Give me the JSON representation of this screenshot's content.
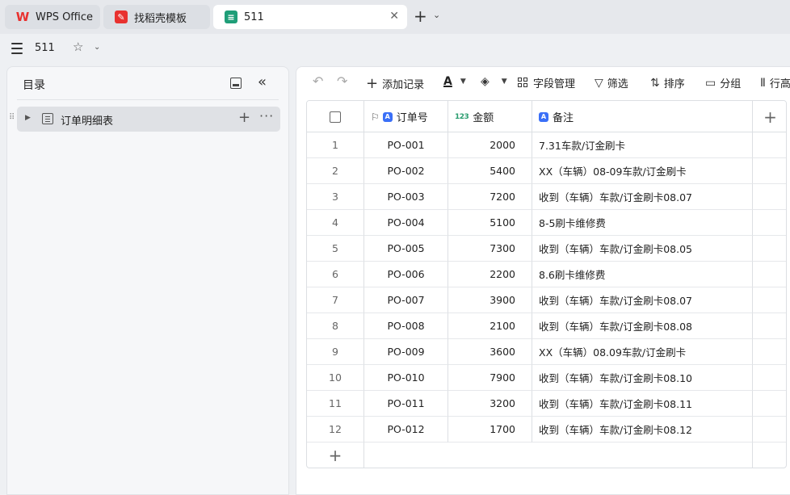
{
  "tabs": [
    {
      "label": "WPS Office",
      "icon": "wps-logo-icon"
    },
    {
      "label": "找稻壳模板",
      "icon": "docer-icon"
    },
    {
      "label": "511",
      "icon": "table-app-icon",
      "active": true
    }
  ],
  "doc": {
    "title": "511"
  },
  "sidebar": {
    "title": "目录",
    "items": [
      {
        "label": "订单明细表"
      }
    ]
  },
  "toolbar": {
    "add_record": "添加记录",
    "field_manage": "字段管理",
    "filter": "筛选",
    "sort": "排序",
    "group": "分组",
    "row": "行高"
  },
  "table": {
    "columns": [
      "订单号",
      "金额",
      "备注"
    ],
    "rows": [
      {
        "idx": "1",
        "id": "PO-001",
        "amount": "2000",
        "note": "7.31车款/订金刷卡"
      },
      {
        "idx": "2",
        "id": "PO-002",
        "amount": "5400",
        "note": "XX（车辆）08-09车款/订金刷卡"
      },
      {
        "idx": "3",
        "id": "PO-003",
        "amount": "7200",
        "note": "收到（车辆）车款/订金刷卡08.07"
      },
      {
        "idx": "4",
        "id": "PO-004",
        "amount": "5100",
        "note": "8-5刷卡维修费"
      },
      {
        "idx": "5",
        "id": "PO-005",
        "amount": "7300",
        "note": "收到（车辆）车款/订金刷卡08.05"
      },
      {
        "idx": "6",
        "id": "PO-006",
        "amount": "2200",
        "note": "8.6刷卡维修费"
      },
      {
        "idx": "7",
        "id": "PO-007",
        "amount": "3900",
        "note": "收到（车辆）车款/订金刷卡08.07"
      },
      {
        "idx": "8",
        "id": "PO-008",
        "amount": "2100",
        "note": "收到（车辆）车款/订金刷卡08.08"
      },
      {
        "idx": "9",
        "id": "PO-009",
        "amount": "3600",
        "note": "XX（车辆）08.09车款/订金刷卡"
      },
      {
        "idx": "10",
        "id": "PO-010",
        "amount": "7900",
        "note": "收到（车辆）车款/订金刷卡08.10"
      },
      {
        "idx": "11",
        "id": "PO-011",
        "amount": "3200",
        "note": "收到（车辆）车款/订金刷卡08.11"
      },
      {
        "idx": "12",
        "id": "PO-012",
        "amount": "1700",
        "note": "收到（车辆）车款/订金刷卡08.12"
      }
    ]
  },
  "colors": {
    "accent": "#3a6ff7",
    "number_type": "#2a9d6f",
    "wps_red": "#e8312f",
    "app_green": "#1f9e78"
  }
}
